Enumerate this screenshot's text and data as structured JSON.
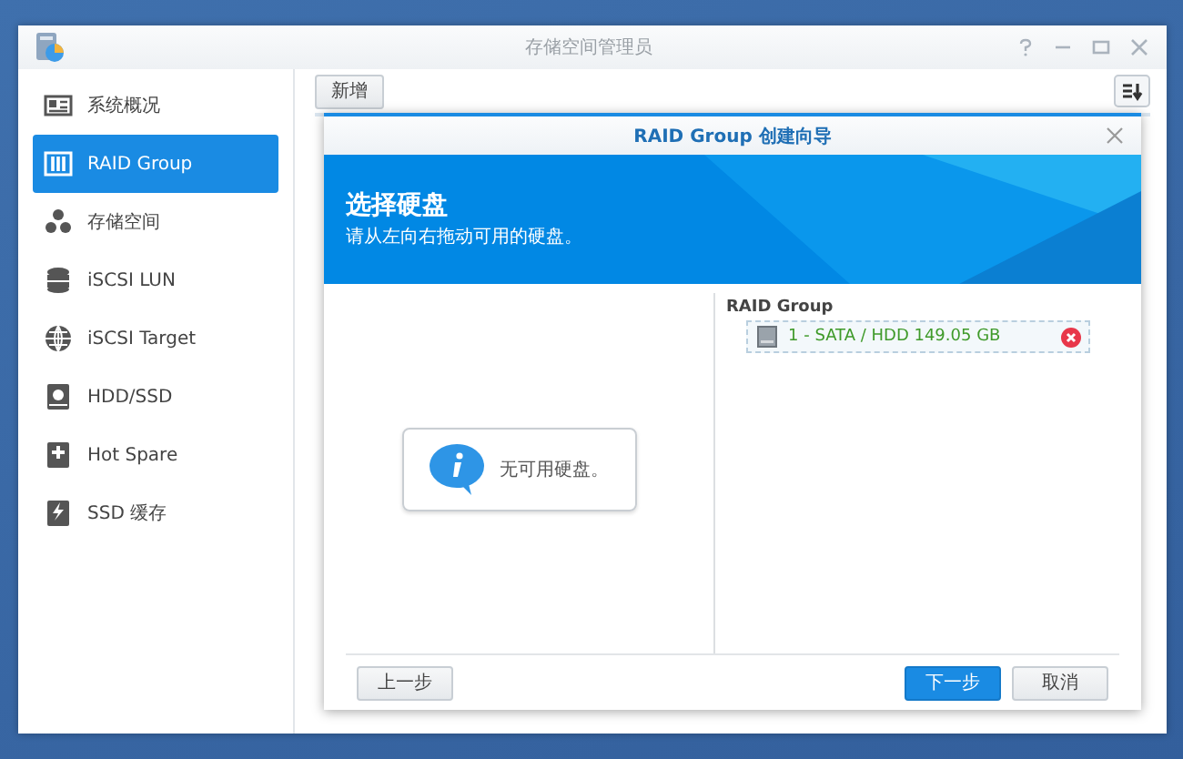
{
  "window": {
    "title": "存储空间管理员"
  },
  "sidebar": {
    "items": [
      {
        "label": "系统概况",
        "kind": "overview",
        "selected": false
      },
      {
        "label": "RAID Group",
        "kind": "raid",
        "selected": true
      },
      {
        "label": "存储空间",
        "kind": "volume",
        "selected": false
      },
      {
        "label": "iSCSI LUN",
        "kind": "lun",
        "selected": false
      },
      {
        "label": "iSCSI Target",
        "kind": "target",
        "selected": false
      },
      {
        "label": "HDD/SSD",
        "kind": "disk",
        "selected": false
      },
      {
        "label": "Hot Spare",
        "kind": "spare",
        "selected": false
      },
      {
        "label": "SSD 缓存",
        "kind": "cache",
        "selected": false
      }
    ]
  },
  "toolbar": {
    "create_button": "新增"
  },
  "dialog": {
    "title": "RAID Group 创建向导",
    "banner": {
      "heading": "选择硬盘",
      "subtitle": "请从左向右拖动可用的硬盘。"
    },
    "available_message": "无可用硬盘。",
    "raid_group": {
      "heading": "RAID Group",
      "disks": [
        {
          "label": "1 - SATA / HDD 149.05 GB"
        }
      ]
    },
    "buttons": {
      "back": "上一步",
      "next": "下一步",
      "cancel": "取消"
    }
  }
}
